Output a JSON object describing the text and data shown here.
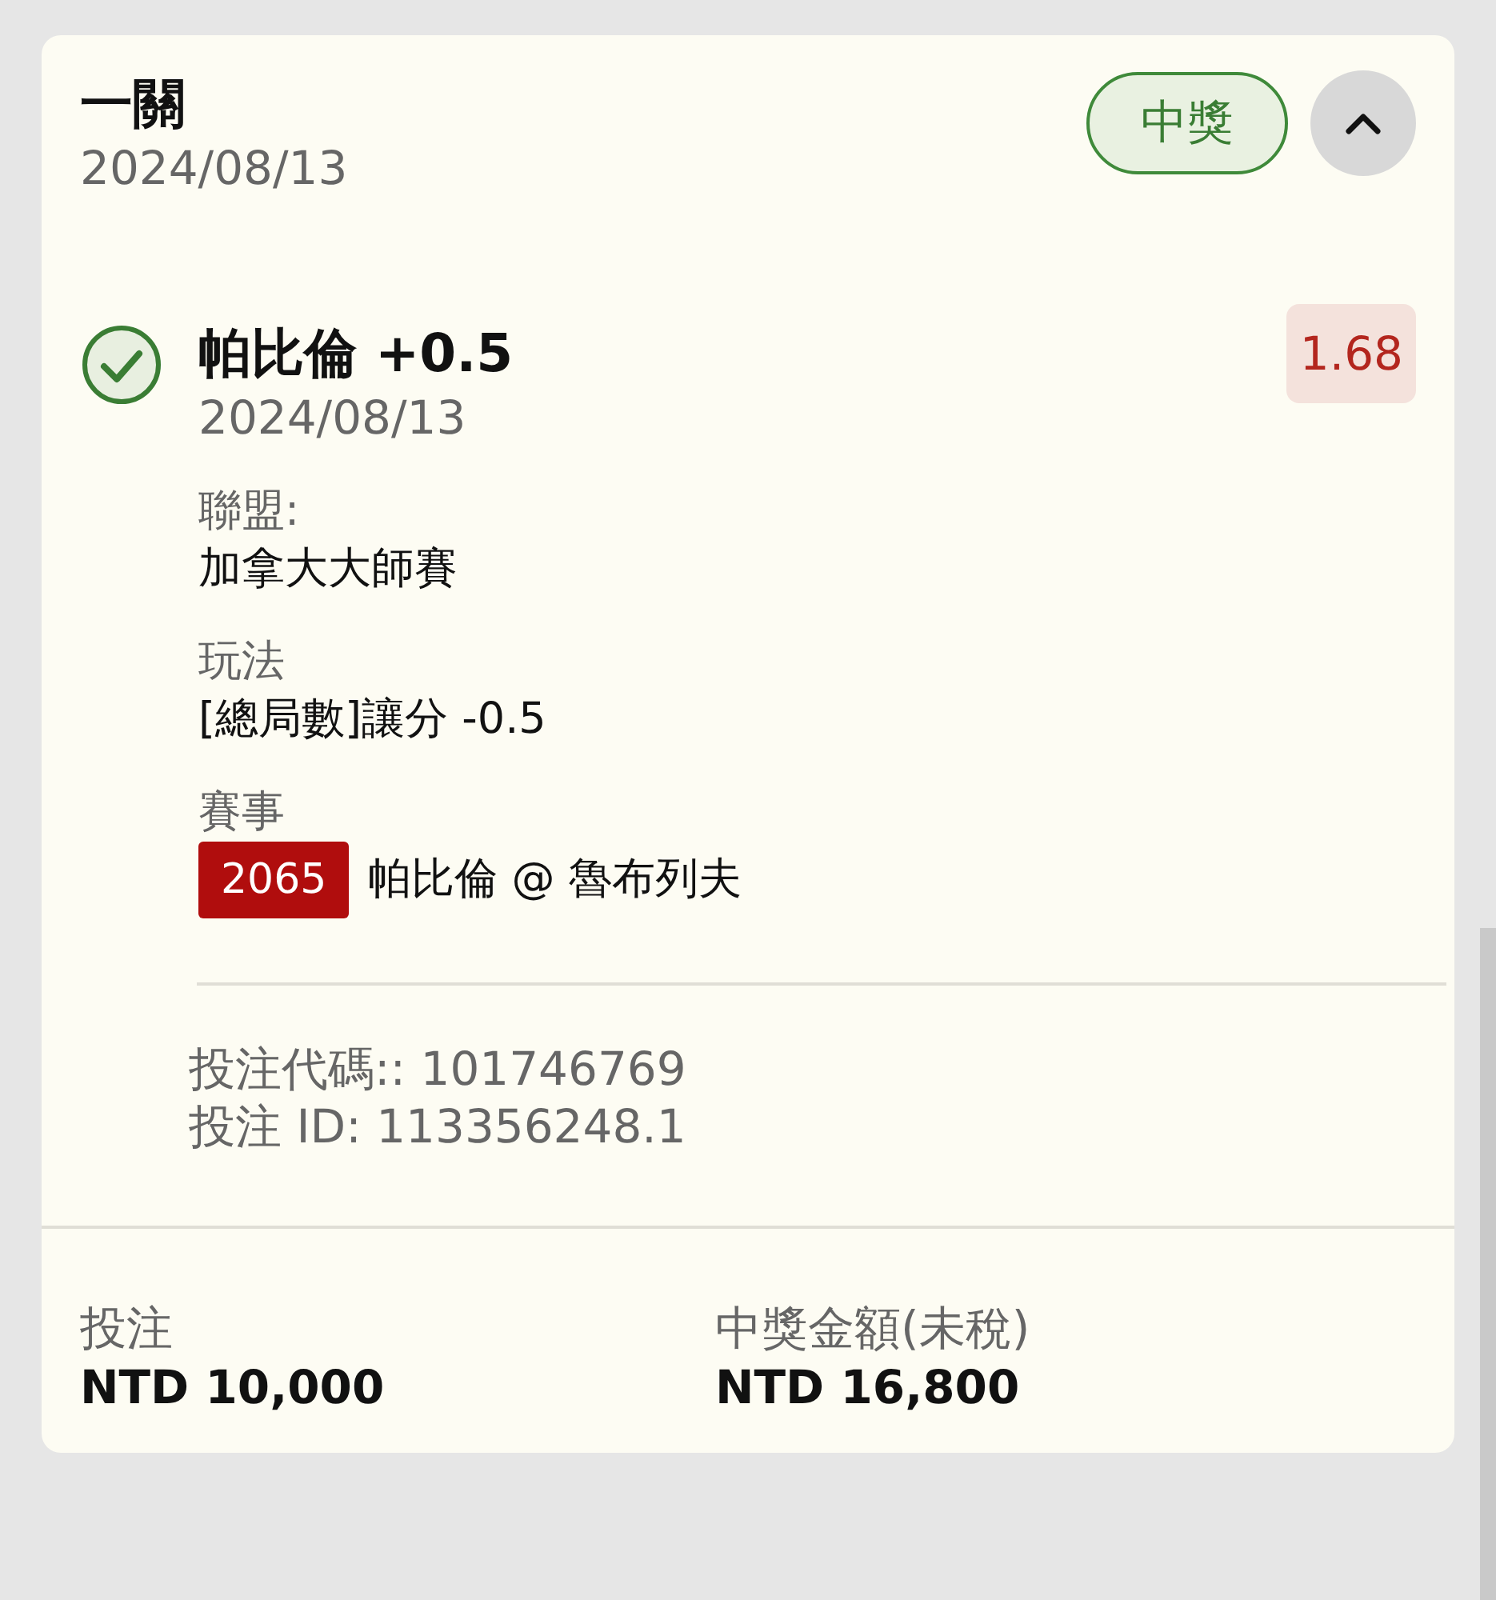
{
  "bet": {
    "title": "一關",
    "date": "2024/08/13",
    "status_badge": {
      "label": "中獎",
      "kind": "won"
    },
    "expanded": true,
    "selection": {
      "won": true,
      "name": "帕比倫 +0.5",
      "date": "2024/08/13",
      "odds": "1.68",
      "details": [
        {
          "label": "聯盟:",
          "value": "加拿大大師賽"
        },
        {
          "label": "玩法",
          "value": "[總局數]讓分 -0.5"
        },
        {
          "label": "賽事",
          "event_number": "2065",
          "value": "帕比倫 @ 魯布列夫"
        }
      ]
    },
    "codes": [
      "投注代碼:: 101746769",
      "投注 ID: 113356248.1"
    ],
    "totals": [
      {
        "label": "投注",
        "value": "NTD 10,000"
      },
      {
        "label": "中獎金額(未稅)",
        "value": "NTD 16,800"
      }
    ]
  }
}
